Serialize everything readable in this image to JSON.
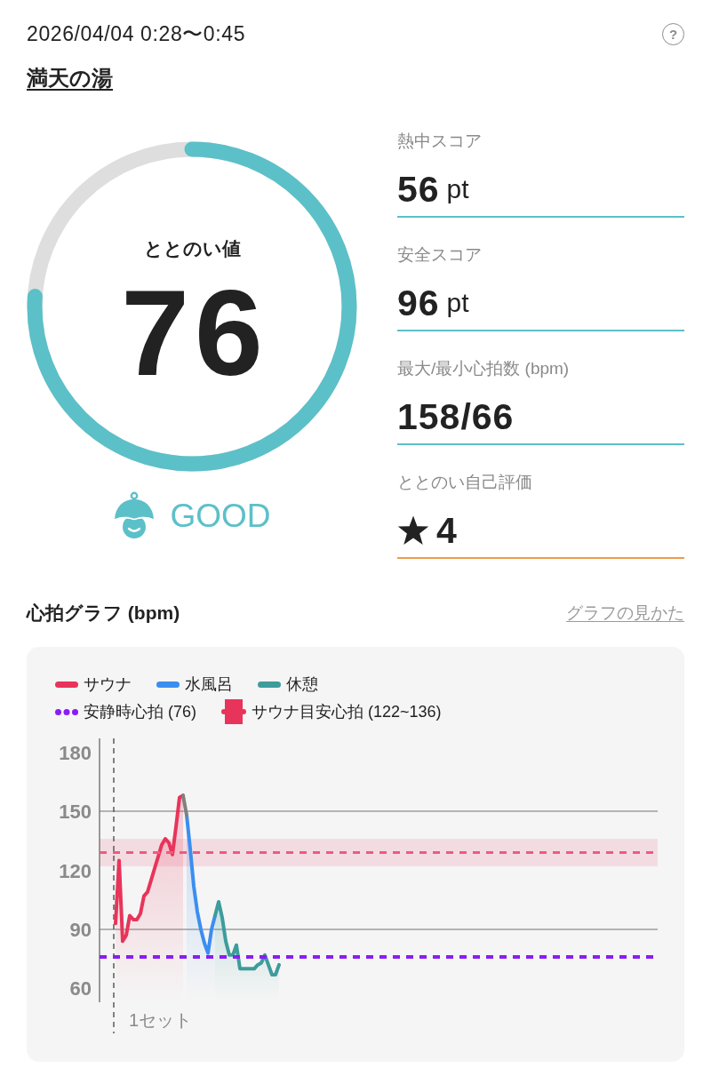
{
  "header": {
    "datetime": "2026/04/04 0:28〜0:45",
    "help": "?",
    "facility": "満天の湯"
  },
  "score": {
    "label": "ととのい値",
    "value": "76",
    "level": 0.76,
    "rating": "GOOD"
  },
  "stats": [
    {
      "kind": "number",
      "label": "熱中スコア",
      "value": "56",
      "unit": "pt",
      "color": "#5cc0c8"
    },
    {
      "kind": "number",
      "label": "安全スコア",
      "value": "96",
      "unit": "pt",
      "color": "#5cc0c8"
    },
    {
      "kind": "number",
      "label": "最大/最小心拍数 (bpm)",
      "value": "158/66",
      "color": "#5cc0c8"
    },
    {
      "kind": "rating",
      "label": "ととのい自己評価",
      "value": "4",
      "color": "#ef9a4a"
    }
  ],
  "heart_chart": {
    "help_link": "グラフの見かた",
    "set_label": "1セット",
    "chart_data": {
      "type": "line",
      "title": "心拍グラフ (bpm)",
      "legend": true,
      "ylim": [
        53,
        187
      ],
      "yticks": [
        60,
        90,
        120,
        150,
        180
      ],
      "series": [
        {
          "name": "サウナ",
          "color": "#e8345a",
          "values": [
            null,
            null,
            null,
            null,
            93,
            125,
            84,
            87,
            97,
            95,
            95,
            98,
            107,
            109,
            115,
            121,
            127,
            133,
            136,
            134,
            128,
            142,
            157,
            158,
            null,
            null,
            null,
            null,
            null,
            null,
            null,
            null,
            null,
            null,
            null,
            null,
            null,
            null,
            null,
            null,
            null,
            null,
            null,
            null,
            null,
            null,
            null,
            null,
            null,
            null,
            null,
            null,
            null,
            null,
            null,
            null,
            null,
            null,
            null,
            null,
            null,
            null,
            null,
            null,
            null,
            null,
            null,
            null,
            null,
            null,
            null,
            null,
            null,
            null,
            null,
            null,
            null,
            null,
            null,
            null,
            null,
            null,
            null,
            null,
            null,
            null,
            null,
            null,
            null,
            null,
            null,
            null,
            null,
            null,
            null,
            null,
            null,
            null,
            null,
            null,
            null,
            null,
            null,
            null,
            null,
            null,
            null,
            null,
            null,
            null,
            null,
            null,
            null,
            null,
            null,
            null,
            null,
            null,
            null,
            null,
            null,
            null,
            null,
            null,
            null,
            null,
            null,
            null,
            null,
            null,
            null,
            null,
            null,
            null,
            null,
            null,
            null,
            null,
            null,
            null,
            null,
            null,
            null,
            null,
            null,
            null,
            null,
            null,
            null,
            null,
            null,
            null,
            null,
            null,
            null,
            null,
            null
          ]
        },
        {
          "name": "水風呂",
          "color": "#3b8ef0",
          "values": [
            null,
            null,
            null,
            null,
            null,
            null,
            null,
            null,
            null,
            null,
            null,
            null,
            null,
            null,
            null,
            null,
            null,
            null,
            null,
            null,
            null,
            null,
            null,
            null,
            148,
            131,
            112,
            99,
            90,
            83,
            78,
            90,
            97,
            null,
            null,
            null,
            null,
            null,
            null,
            null,
            null,
            null,
            null,
            null,
            null,
            null,
            null,
            null,
            null,
            null,
            null,
            null,
            null,
            null,
            null,
            null,
            null,
            null,
            null,
            null,
            null,
            null,
            null,
            null,
            null,
            null,
            null,
            null,
            null,
            null,
            null,
            null,
            null,
            null,
            null,
            null,
            null,
            null,
            null,
            null,
            null,
            null,
            null,
            null,
            null,
            null,
            null,
            null,
            null,
            null,
            null,
            null,
            null,
            null,
            null,
            null,
            null,
            null,
            null,
            null,
            null,
            null,
            null,
            null,
            null,
            null,
            null,
            null,
            null,
            null,
            null,
            null,
            null,
            null,
            null,
            null,
            null,
            null,
            null,
            null,
            null,
            null,
            null,
            null,
            null,
            null,
            null,
            null,
            null,
            null,
            null,
            null,
            null,
            null,
            null,
            null,
            null,
            null,
            null,
            null,
            null,
            null,
            null,
            null,
            null,
            null,
            null,
            null,
            null,
            null
          ]
        },
        {
          "name": "休憩",
          "color": "#3d9c9c",
          "values": [
            null,
            null,
            null,
            null,
            null,
            null,
            null,
            null,
            null,
            null,
            null,
            null,
            null,
            null,
            null,
            null,
            null,
            null,
            null,
            null,
            null,
            null,
            null,
            null,
            null,
            null,
            null,
            null,
            null,
            null,
            null,
            null,
            97,
            104,
            96,
            84,
            77,
            77,
            82,
            70,
            70,
            70,
            70,
            70,
            72,
            73,
            77,
            72,
            67,
            67,
            72,
            null,
            null,
            null,
            null,
            null,
            null,
            null,
            null,
            null,
            null,
            null,
            null,
            null,
            null,
            null,
            null,
            null,
            null,
            null,
            null,
            null,
            null,
            null,
            null,
            null,
            null,
            null,
            null,
            null,
            null,
            null,
            null,
            null,
            null,
            null,
            null,
            null,
            null,
            null,
            null,
            null,
            null,
            null,
            null,
            null,
            null,
            null,
            null,
            null,
            null,
            null,
            null,
            null,
            null,
            null,
            null,
            null,
            null,
            null,
            null,
            null,
            null,
            null,
            null,
            null,
            null,
            null,
            null,
            null,
            null,
            null,
            null,
            null,
            null,
            null,
            null,
            null,
            null,
            null,
            null,
            null,
            null,
            null,
            null,
            null,
            null,
            null,
            null,
            null,
            null,
            null,
            null,
            null,
            null,
            null,
            null,
            null,
            null,
            null,
            null
          ]
        },
        {
          "color": "#808080",
          "values": [
            null,
            null,
            null,
            null,
            null,
            null,
            null,
            null,
            null,
            null,
            null,
            null,
            null,
            null,
            null,
            null,
            null,
            null,
            null,
            null,
            null,
            null,
            null,
            158,
            148,
            null,
            null,
            null,
            null,
            null,
            null,
            null,
            null,
            null,
            null,
            null,
            null,
            null,
            null,
            null,
            null,
            null,
            null,
            null,
            null,
            null,
            null,
            null,
            null,
            null,
            null,
            null,
            null,
            null,
            null,
            null,
            null,
            null,
            null,
            null,
            null,
            null,
            null,
            null,
            null,
            null,
            null,
            null,
            null,
            null,
            null,
            null,
            null,
            null,
            null,
            null,
            null,
            null,
            null,
            null,
            null,
            null,
            null,
            null,
            null,
            null,
            null,
            null,
            null,
            null,
            null,
            null,
            null,
            null,
            null,
            null,
            null,
            null,
            null,
            null,
            null,
            null,
            null,
            null,
            null,
            null,
            null,
            null,
            null,
            null,
            null,
            null,
            null,
            null,
            null,
            null,
            null,
            null,
            null,
            null,
            null,
            null,
            null,
            null,
            null,
            null,
            null,
            null,
            null,
            null,
            null,
            null,
            null,
            null,
            null,
            null,
            null,
            null,
            null,
            null,
            null,
            null,
            null,
            null,
            null,
            null,
            null,
            null,
            null,
            null,
            null,
            null,
            null,
            null,
            null,
            null,
            null
          ]
        }
      ],
      "ref_lines": [
        {
          "axis": "y",
          "value": 129,
          "color": "#ef5a80"
        },
        {
          "axis": "y",
          "value": 76,
          "label": "安静時心拍 (76)",
          "color": "#8a1cf5"
        }
      ],
      "bands": [
        {
          "axis": "y",
          "from": 122,
          "to": 136,
          "label": "サウナ目安心拍 (122~136)",
          "color": "#e8345a"
        }
      ]
    }
  }
}
